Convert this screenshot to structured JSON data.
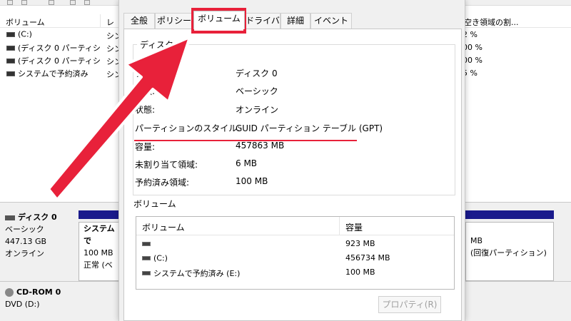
{
  "background": {
    "columns": {
      "volume": "ボリューム",
      "layout": "レ",
      "free_pct": "空き領域の割..."
    },
    "volumes": [
      {
        "name": "(C:)",
        "layout": "シン",
        "free_pct": "2 %"
      },
      {
        "name": "(ディスク 0 パーティシ",
        "layout": "シン",
        "free_pct": "00 %"
      },
      {
        "name": "(ディスク 0 パーティシ",
        "layout": "シン",
        "free_pct": "00 %"
      },
      {
        "name": "システムで予約済み",
        "layout": "シン",
        "free_pct": "5 %"
      }
    ],
    "disk0": {
      "name": "ディスク 0",
      "type": "ベーシック",
      "size": "447.13 GB",
      "status": "オンライン"
    },
    "partition1": {
      "name": "システムで",
      "size": "100 MB",
      "status": "正常 (ベ"
    },
    "right_partition": {
      "size": "MB",
      "status": "(回復パーティション)"
    },
    "cdrom": {
      "name": "CD-ROM 0",
      "drive": "DVD (D:)"
    }
  },
  "dialog": {
    "tabs": [
      {
        "label": "全般",
        "active": false
      },
      {
        "label": "ポリシー",
        "active": false
      },
      {
        "label": "ボリューム",
        "active": true
      },
      {
        "label": "ドライバー",
        "active": false
      },
      {
        "label": "詳細",
        "active": false
      },
      {
        "label": "イベント",
        "active": false
      }
    ],
    "group_title": "ディスク",
    "properties": [
      {
        "label": "ディスク:",
        "value": "ディスク 0"
      },
      {
        "label": "種類:",
        "value": "ベーシック"
      },
      {
        "label": "状態:",
        "value": "オンライン"
      },
      {
        "label": "パーティションのスタイル:",
        "value": "GUID パーティション テーブル (GPT)"
      },
      {
        "label": "容量:",
        "value": "457863 MB"
      },
      {
        "label": "未割り当て領域:",
        "value": "6 MB"
      },
      {
        "label": "予約済み領域:",
        "value": "100 MB"
      }
    ],
    "volumes_title": "ボリューム",
    "volumes_table": {
      "headers": [
        "ボリューム",
        "容量"
      ],
      "rows": [
        {
          "volume": "",
          "capacity": "923 MB"
        },
        {
          "volume": "(C:)",
          "capacity": "456734 MB"
        },
        {
          "volume": "システムで予約済み (E:)",
          "capacity": "100 MB"
        }
      ]
    },
    "properties_button": "プロパティ(R)"
  },
  "annotation": {
    "highlight_color": "#e8213a",
    "arrow_target": "ボリューム tab"
  }
}
